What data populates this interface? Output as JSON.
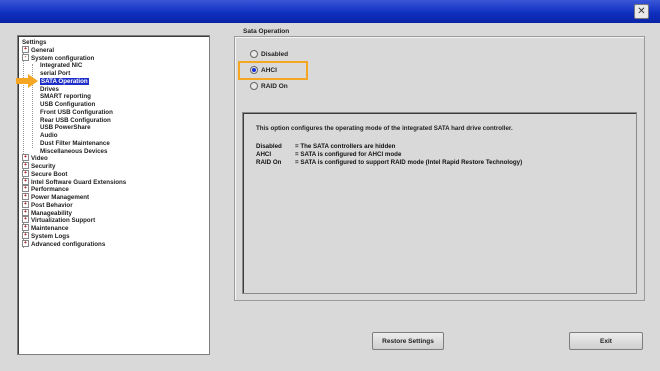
{
  "titlebar": {
    "close_icon": "✕"
  },
  "tree": {
    "items": [
      {
        "label": "Settings",
        "level": 0,
        "expander": ""
      },
      {
        "label": "General",
        "level": 0,
        "expander": "+"
      },
      {
        "label": "System configuration",
        "level": 0,
        "expander": "-"
      },
      {
        "label": "Integrated NIC",
        "level": 1,
        "expander": ""
      },
      {
        "label": "serial Port",
        "level": 1,
        "expander": ""
      },
      {
        "label": "SATA Operation",
        "level": 1,
        "expander": "",
        "selected": true
      },
      {
        "label": "Drives",
        "level": 1,
        "expander": ""
      },
      {
        "label": "SMART reporting",
        "level": 1,
        "expander": ""
      },
      {
        "label": "USB Configuration",
        "level": 1,
        "expander": ""
      },
      {
        "label": "Front USB Configuration",
        "level": 1,
        "expander": ""
      },
      {
        "label": "Rear USB Configuration",
        "level": 1,
        "expander": ""
      },
      {
        "label": "USB PowerShare",
        "level": 1,
        "expander": ""
      },
      {
        "label": "Audio",
        "level": 1,
        "expander": ""
      },
      {
        "label": "Dust Filter Maintenance",
        "level": 1,
        "expander": ""
      },
      {
        "label": "Miscellaneous Devices",
        "level": 1,
        "expander": ""
      },
      {
        "label": "Video",
        "level": 0,
        "expander": "+"
      },
      {
        "label": "Security",
        "level": 0,
        "expander": "+"
      },
      {
        "label": "Secure Boot",
        "level": 0,
        "expander": "+"
      },
      {
        "label": "Intel Software Guard Extensions",
        "level": 0,
        "expander": "+"
      },
      {
        "label": "Performance",
        "level": 0,
        "expander": "+"
      },
      {
        "label": "Power Management",
        "level": 0,
        "expander": "+"
      },
      {
        "label": "Post Behavior",
        "level": 0,
        "expander": "+"
      },
      {
        "label": "Manageability",
        "level": 0,
        "expander": "+"
      },
      {
        "label": "Virtualization Support",
        "level": 0,
        "expander": "+"
      },
      {
        "label": "Maintenance",
        "level": 0,
        "expander": "+"
      },
      {
        "label": "System Logs",
        "level": 0,
        "expander": "+"
      },
      {
        "label": "Advanced configurations",
        "level": 0,
        "expander": "+"
      }
    ]
  },
  "sata": {
    "group_title": "Sata Operation",
    "options": [
      {
        "label": "Disabled",
        "selected": false
      },
      {
        "label": "AHCI",
        "selected": true
      },
      {
        "label": "RAID On",
        "selected": false
      }
    ]
  },
  "help": {
    "intro": "This option configures the operating mode of the integrated SATA hard drive controller.",
    "rows": [
      {
        "key": "Disabled",
        "value": "= The SATA controllers are hidden"
      },
      {
        "key": "AHCI",
        "value": "= SATA is configured for AHCI mode"
      },
      {
        "key": "RAID On",
        "value": "= SATA is configured to support RAID mode (Intel Rapid Restore Technology)"
      }
    ]
  },
  "buttons": {
    "restore": "Restore Settings",
    "exit": "Exit"
  },
  "colors": {
    "titlebar": "#1a36c8",
    "selection": "#1e2ec8",
    "annotation": "#f5a623"
  }
}
